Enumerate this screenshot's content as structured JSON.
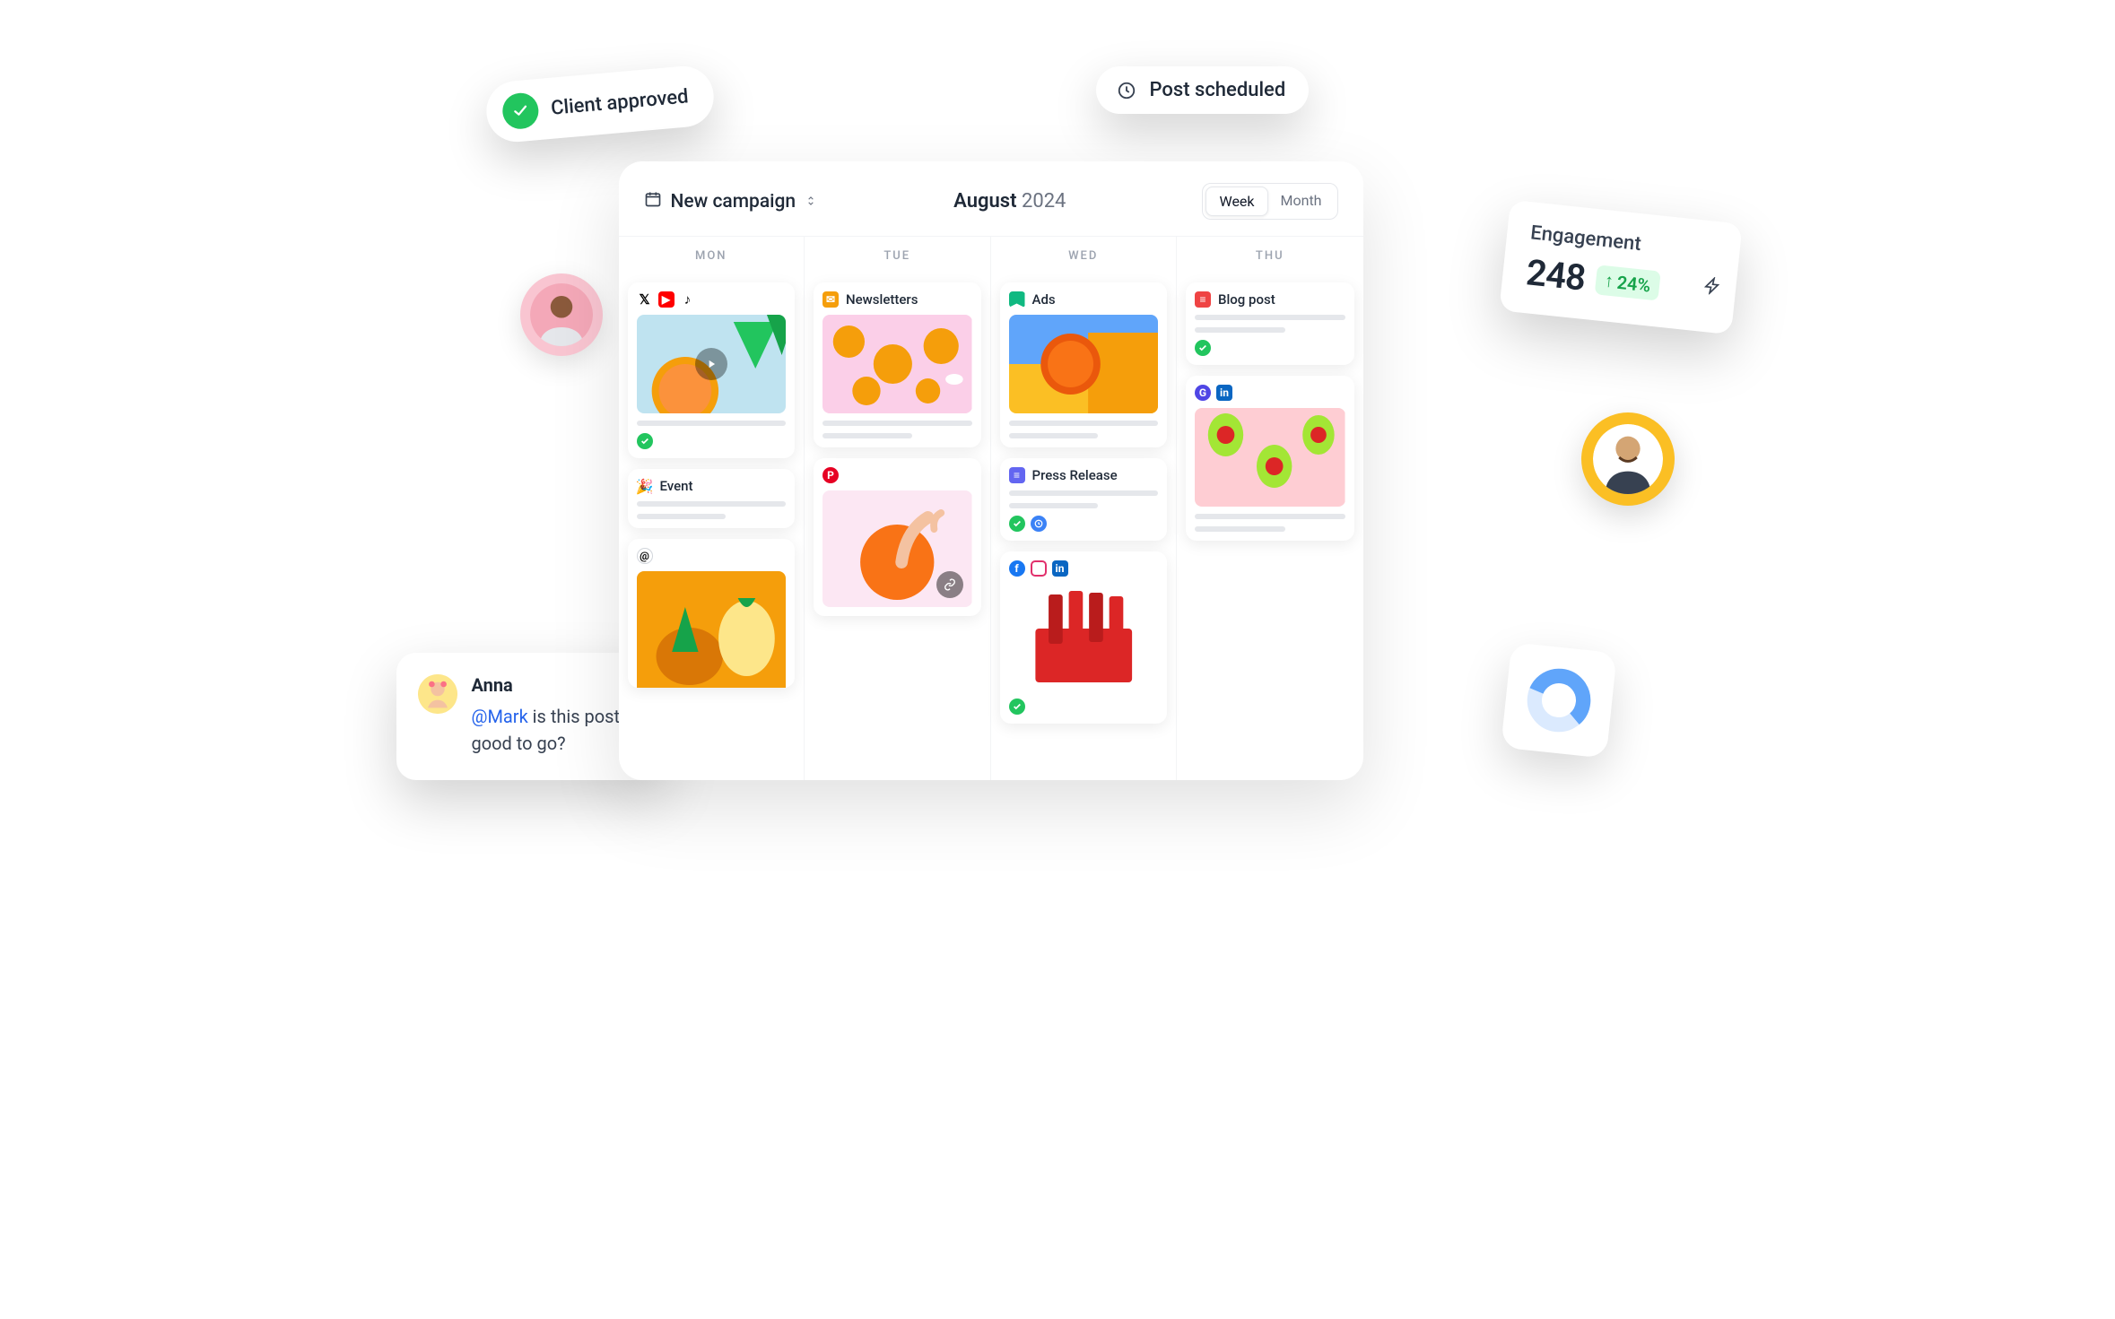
{
  "pills": {
    "client_approved": "Client approved",
    "post_scheduled": "Post scheduled"
  },
  "engagement": {
    "title": "Engagement",
    "value": "248",
    "delta": "24%"
  },
  "comment": {
    "author": "Anna",
    "mention": "@Mark",
    "rest": " is this post good to go?"
  },
  "header": {
    "campaign_label": "New campaign",
    "month": "August",
    "year": "2024",
    "view_week": "Week",
    "view_month": "Month"
  },
  "days": [
    "MON",
    "TUE",
    "WED",
    "THU"
  ],
  "cards": {
    "mon_event": "Event",
    "tue_news": "Newsletters",
    "wed_ads": "Ads",
    "wed_press": "Press Release",
    "thu_blog": "Blog post"
  }
}
